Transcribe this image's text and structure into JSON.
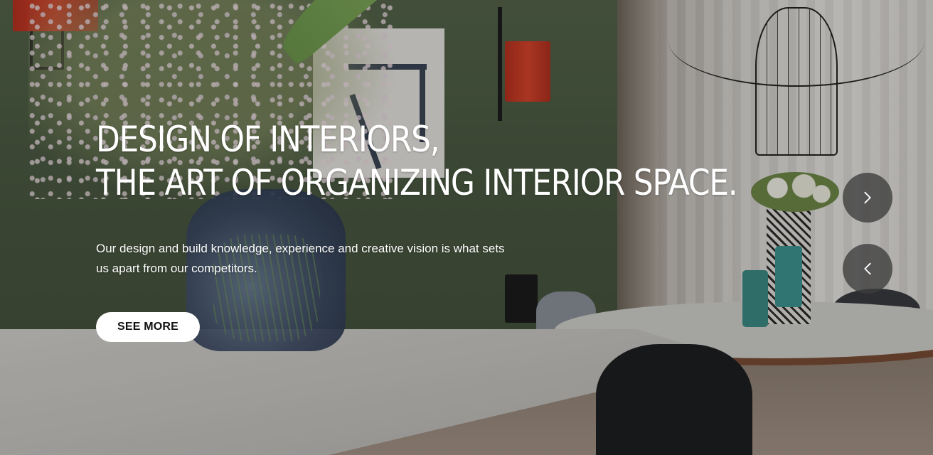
{
  "hero": {
    "headline_line1": "DESIGN OF INTERIORS,",
    "headline_line2": "THE ART OF ORGANIZING INTERIOR SPACE.",
    "subtext_line1": "Our design and build knowledge, experience and creative vision is what sets",
    "subtext_line2": "us apart from our competitors.",
    "cta_label": "SEE MORE"
  },
  "slider_nav": {
    "next_icon": "chevron-right-icon",
    "prev_icon": "chevron-left-icon"
  },
  "colors": {
    "text": "#ffffff",
    "button_bg": "#ffffff",
    "button_text": "#111111",
    "nav_bg": "#3c3c3c"
  }
}
